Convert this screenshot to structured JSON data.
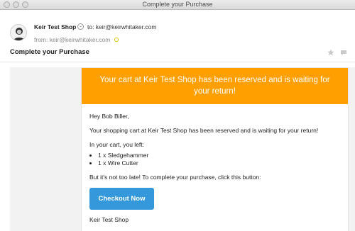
{
  "window": {
    "title": "Complete your Purchase"
  },
  "header": {
    "sender": "Keir Test Shop",
    "to": "to: keir@keirwhitaker.com",
    "from": "from: keir@keirwhitaker.com",
    "subject": "Complete your Purchase"
  },
  "email": {
    "banner": "Your cart at Keir Test Shop has been reserved and is waiting for your return!",
    "greeting": "Hey Bob Biller,",
    "intro": "Your shopping cart at Keir Test Shop has been reserved and is waiting for your return!",
    "cart_label": "In your cart, you left:",
    "items": [
      "1 x Sledgehammer",
      "1 x Wire Cutter"
    ],
    "cta_text": "But it's not too late! To complete your purchase, click this button:",
    "button_label": "Checkout Now",
    "signature": "Keir Test Shop"
  },
  "colors": {
    "banner": "#ff9f00",
    "button": "#3498db"
  },
  "icons": [
    "avatar",
    "chevron-down-icon",
    "star-icon",
    "reply-bubble-icon"
  ]
}
